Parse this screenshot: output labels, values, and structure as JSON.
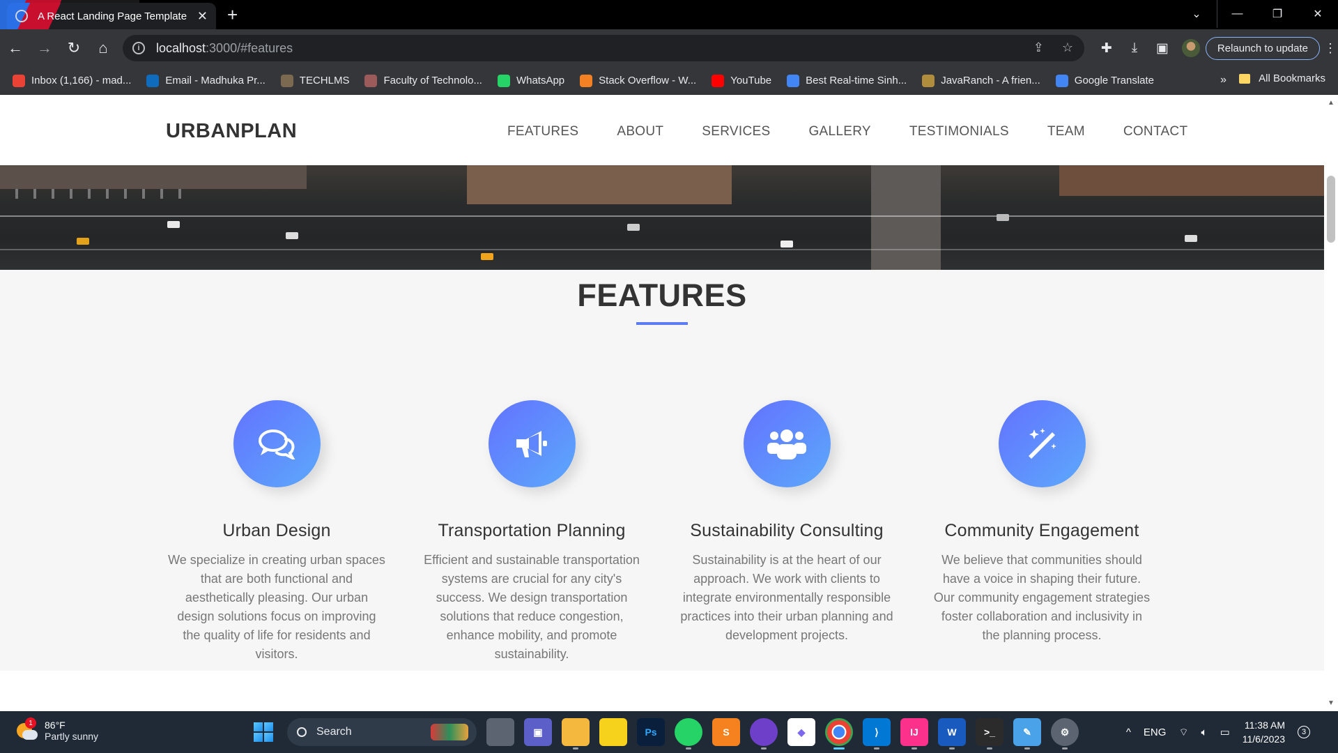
{
  "browser": {
    "tab_title": "A React Landing Page Template",
    "url_host": "localhost",
    "url_path": ":3000/#features",
    "relaunch_label": "Relaunch to update"
  },
  "bookmarks": [
    {
      "label": "Inbox (1,166) - mad...",
      "icon": "gmail-icon",
      "color": "#ea4335"
    },
    {
      "label": "Email - Madhuka Pr...",
      "icon": "outlook-icon",
      "color": "#0f6cbd"
    },
    {
      "label": "TECHLMS",
      "icon": "moodle-icon",
      "color": "#7b6a4f"
    },
    {
      "label": "Faculty of Technolo...",
      "icon": "university-icon",
      "color": "#9c5a5a"
    },
    {
      "label": "WhatsApp",
      "icon": "whatsapp-icon",
      "color": "#25d366"
    },
    {
      "label": "Stack Overflow - W...",
      "icon": "stackoverflow-icon",
      "color": "#f48024"
    },
    {
      "label": "YouTube",
      "icon": "youtube-icon",
      "color": "#ff0000"
    },
    {
      "label": "Best Real-time Sinh...",
      "icon": "google-icon",
      "color": "#4285f4"
    },
    {
      "label": "JavaRanch - A frien...",
      "icon": "javaranch-icon",
      "color": "#b08d3c"
    },
    {
      "label": "Google Translate",
      "icon": "translate-icon",
      "color": "#4285f4"
    }
  ],
  "bookmarks_all_label": "All Bookmarks",
  "site": {
    "brand": "URBANPLAN",
    "menu": [
      "FEATURES",
      "ABOUT",
      "SERVICES",
      "GALLERY",
      "TESTIMONIALS",
      "TEAM",
      "CONTACT"
    ]
  },
  "features": {
    "title": "FEATURES",
    "items": [
      {
        "icon": "chat-bubbles-icon",
        "title": "Urban Design",
        "text": "We specialize in creating urban spaces that are both functional and aesthetically pleasing. Our urban design solutions focus on improving the quality of life for residents and visitors."
      },
      {
        "icon": "megaphone-icon",
        "title": "Transportation Planning",
        "text": "Efficient and sustainable transportation systems are crucial for any city's success. We design transportation solutions that reduce congestion, enhance mobility, and promote sustainability."
      },
      {
        "icon": "group-icon",
        "title": "Sustainability Consulting",
        "text": "Sustainability is at the heart of our approach. We work with clients to integrate environmentally responsible practices into their urban planning and development projects."
      },
      {
        "icon": "magic-wand-icon",
        "title": "Community Engagement",
        "text": "We believe that communities should have a voice in shaping their future. Our community engagement strategies foster collaboration and inclusivity in the planning process."
      }
    ]
  },
  "taskbar": {
    "weather_temp": "86°F",
    "weather_desc": "Partly sunny",
    "weather_badge": "1",
    "search_label": "Search",
    "lang": "ENG",
    "time": "11:38 AM",
    "date": "11/6/2023",
    "notification_count": "3"
  },
  "colors": {
    "accent": "#5b7cf5",
    "icon_gradient_start": "#6372ff",
    "icon_gradient_end": "#5ca9fb"
  }
}
